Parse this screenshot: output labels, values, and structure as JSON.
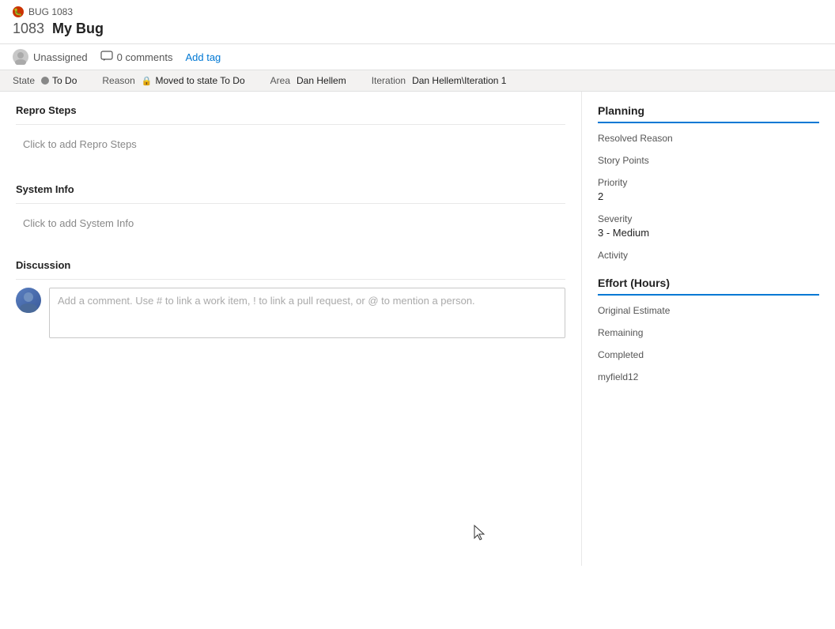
{
  "titleBar": {
    "bugLabel": "BUG 1083",
    "bugIconText": "🐛",
    "workItemId": "1083",
    "workItemTitle": "My Bug"
  },
  "metaBar": {
    "assigneeLabel": "Unassigned",
    "commentsCount": "0 comments",
    "addTagLabel": "Add tag"
  },
  "fieldsBar": {
    "stateLabel": "State",
    "stateValue": "To Do",
    "reasonLabel": "Reason",
    "reasonValue": "Moved to state To Do",
    "areaLabel": "Area",
    "areaValue": "Dan Hellem",
    "iterationLabel": "Iteration",
    "iterationValue": "Dan Hellem\\Iteration 1"
  },
  "leftPanel": {
    "reproStepsTitle": "Repro Steps",
    "reproStepsPlaceholder": "Click to add Repro Steps",
    "systemInfoTitle": "System Info",
    "systemInfoPlaceholder": "Click to add System Info",
    "discussionTitle": "Discussion",
    "commentPlaceholder": "Add a comment. Use # to link a work item, ! to link a pull request, or @ to mention a person."
  },
  "rightPanel": {
    "planningTitle": "Planning",
    "resolvedReasonLabel": "Resolved Reason",
    "resolvedReasonValue": "",
    "storyPointsLabel": "Story Points",
    "storyPointsValue": "",
    "priorityLabel": "Priority",
    "priorityValue": "2",
    "severityLabel": "Severity",
    "severityValue": "3 - Medium",
    "activityLabel": "Activity",
    "activityValue": "",
    "effortTitle": "Effort (Hours)",
    "originalEstimateLabel": "Original Estimate",
    "originalEstimateValue": "",
    "remainingLabel": "Remaining",
    "remainingValue": "",
    "completedLabel": "Completed",
    "completedValue": "",
    "myfield12Label": "myfield12",
    "myfield12Value": ""
  }
}
